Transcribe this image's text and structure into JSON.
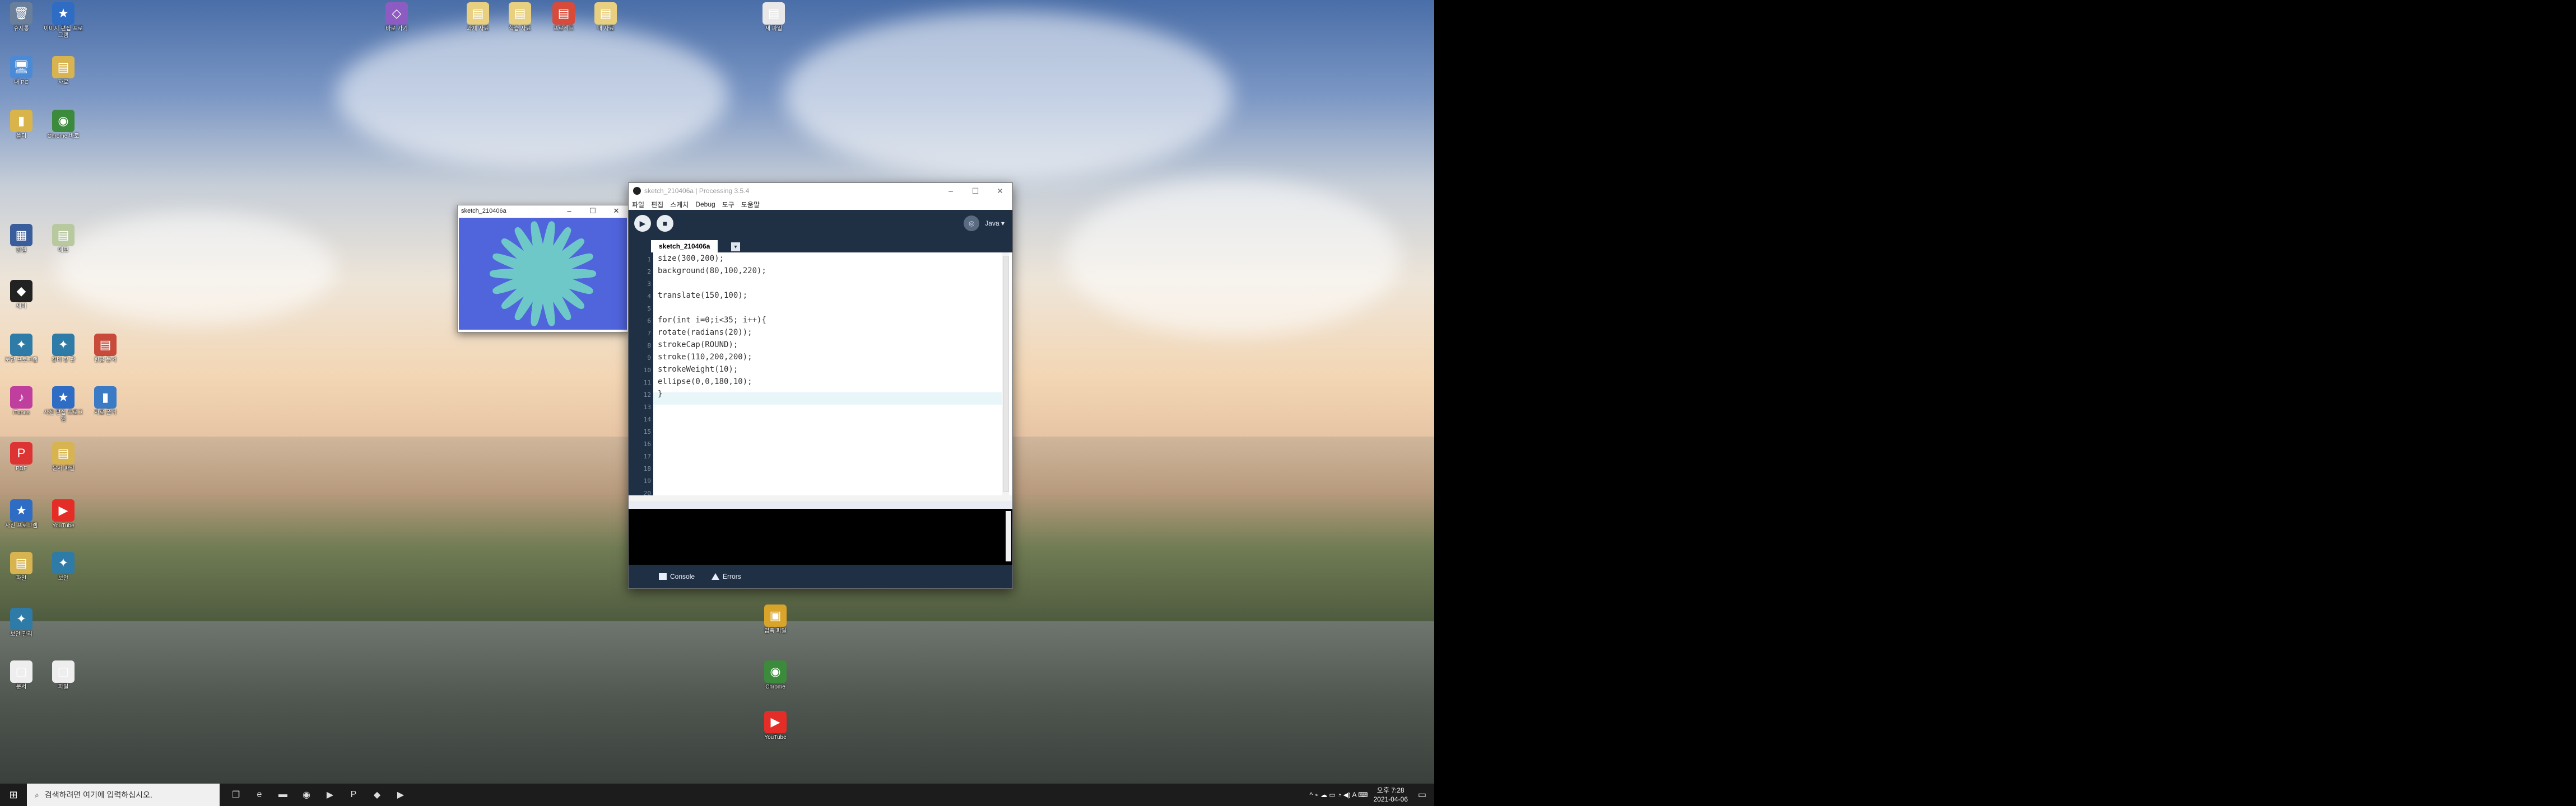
{
  "desktop": {
    "icons": [
      {
        "label": "휴지통",
        "glyph": "🗑",
        "color": "#6a7f9a"
      },
      {
        "label": "이미지 편집 프로그램",
        "glyph": "★",
        "color": "#2f6cc4"
      },
      {
        "label": "내 PC",
        "glyph": "🖥",
        "color": "#4a8ad6"
      },
      {
        "label": "자료",
        "glyph": "▤",
        "color": "#d7b450"
      },
      {
        "label": "폴더",
        "glyph": "▮",
        "color": "#d9b44a"
      },
      {
        "label": "Chrome 바로",
        "glyph": "◉",
        "color": "#3c8a3c"
      },
      {
        "label": "한셀",
        "glyph": "▦",
        "color": "#3a5e9c"
      },
      {
        "label": "메모",
        "glyph": "▤",
        "color": "#b8c9a0"
      },
      {
        "label": "제이",
        "glyph": "◆",
        "color": "#222"
      },
      {
        "label": "보안 프로그램",
        "glyph": "✦",
        "color": "#2d7ba6"
      },
      {
        "label": "경비 장 관",
        "glyph": "✦",
        "color": "#2d7ba6"
      },
      {
        "label": "한글 문서",
        "glyph": "▤",
        "color": "#c84a3a"
      },
      {
        "label": "iTunes",
        "glyph": "♪",
        "color": "#c03f9e"
      },
      {
        "label": "사진 편집 프로그램",
        "glyph": "★",
        "color": "#2f6cc4"
      },
      {
        "label": "자료 폴더",
        "glyph": "▮",
        "color": "#3b7ac4"
      },
      {
        "label": "PDF",
        "glyph": "P",
        "color": "#d33"
      },
      {
        "label": "문서 파일",
        "glyph": "▤",
        "color": "#d7b450"
      },
      {
        "label": "사진 프로그램",
        "glyph": "★",
        "color": "#2f6cc4"
      },
      {
        "label": "YouTube",
        "glyph": "▶",
        "color": "#e52d27"
      },
      {
        "label": "파일",
        "glyph": "▤",
        "color": "#d7b450"
      },
      {
        "label": "보안",
        "glyph": "✦",
        "color": "#2d7ba6"
      },
      {
        "label": "보안 관리",
        "glyph": "✦",
        "color": "#2d7ba6"
      },
      {
        "label": "문서",
        "glyph": "▢",
        "color": "#eee"
      },
      {
        "label": "파일",
        "glyph": "▢",
        "color": "#eee"
      },
      {
        "label": "바로 가기",
        "glyph": "◇",
        "color": "#8d5cc2"
      },
      {
        "label": "과제 자료",
        "glyph": "▤",
        "color": "#e8d080"
      },
      {
        "label": "학습 자료",
        "glyph": "▤",
        "color": "#e8d080"
      },
      {
        "label": "프로젝트",
        "glyph": "▤",
        "color": "#d84a3a"
      },
      {
        "label": "내 자료",
        "glyph": "▤",
        "color": "#e8d080"
      },
      {
        "label": "새 파일",
        "glyph": "▤",
        "color": "#e8e8e8"
      },
      {
        "label": "압축 파일",
        "glyph": "▣",
        "color": "#d9a42a"
      },
      {
        "label": "Chrome",
        "glyph": "◉",
        "color": "#3c8a3c"
      },
      {
        "label": "YouTube",
        "glyph": "▶",
        "color": "#e52d27"
      }
    ]
  },
  "sketch_window": {
    "title": "sketch_210406a",
    "minimize": "–",
    "maximize": "☐",
    "close": "✕",
    "background": "#5064dc",
    "stroke": "#6ec8c8",
    "petals": 36,
    "petal_length": 180,
    "petal_height": 10,
    "stroke_weight": 10
  },
  "ide": {
    "title": "sketch_210406a | Processing 3.5.4",
    "minimize": "–",
    "maximize": "☐",
    "close": "✕",
    "menu": [
      "파일",
      "편집",
      "스케치",
      "Debug",
      "도구",
      "도움말"
    ],
    "run_icon": "▶",
    "stop_icon": "■",
    "debug_icon": "◎",
    "mode": "Java ▾",
    "tab": "sketch_210406a",
    "tab_arrow": "▾",
    "line_numbers": [
      "1",
      "2",
      "3",
      "4",
      "5",
      "6",
      "7",
      "8",
      "9",
      "10",
      "11",
      "12",
      "13",
      "14",
      "15",
      "16",
      "17",
      "18",
      "19",
      "20"
    ],
    "code": [
      "size(300,200);",
      "background(80,100,220);",
      "",
      "translate(150,100);",
      "",
      "for(int i=0;i<35; i++){",
      "rotate(radians(20));",
      "strokeCap(ROUND);",
      "stroke(110,200,200);",
      "strokeWeight(10);",
      "ellipse(0,0,180,10);",
      "}"
    ],
    "console_tab": "Console",
    "errors_tab": "Errors"
  },
  "taskbar": {
    "start_icon": "⊞",
    "search_icon": "⌕",
    "search_placeholder": "검색하려면 여기에 입력하십시오.",
    "apps": [
      {
        "name": "task-view-icon",
        "glyph": "❐"
      },
      {
        "name": "edge-icon",
        "glyph": "e"
      },
      {
        "name": "file-explorer-icon",
        "glyph": "▬"
      },
      {
        "name": "chrome-icon",
        "glyph": "◉"
      },
      {
        "name": "youtube-icon",
        "glyph": "▶"
      },
      {
        "name": "powerpoint-icon",
        "glyph": "P"
      },
      {
        "name": "app-icon",
        "glyph": "◆"
      },
      {
        "name": "processing-icon",
        "glyph": "▶"
      }
    ],
    "tray_icons": "^ ⌁ ☁ ▭ ◔ ◀) A ⌨",
    "time": "오후 7:28",
    "date": "2021-04-06",
    "notification_icon": "▭"
  }
}
